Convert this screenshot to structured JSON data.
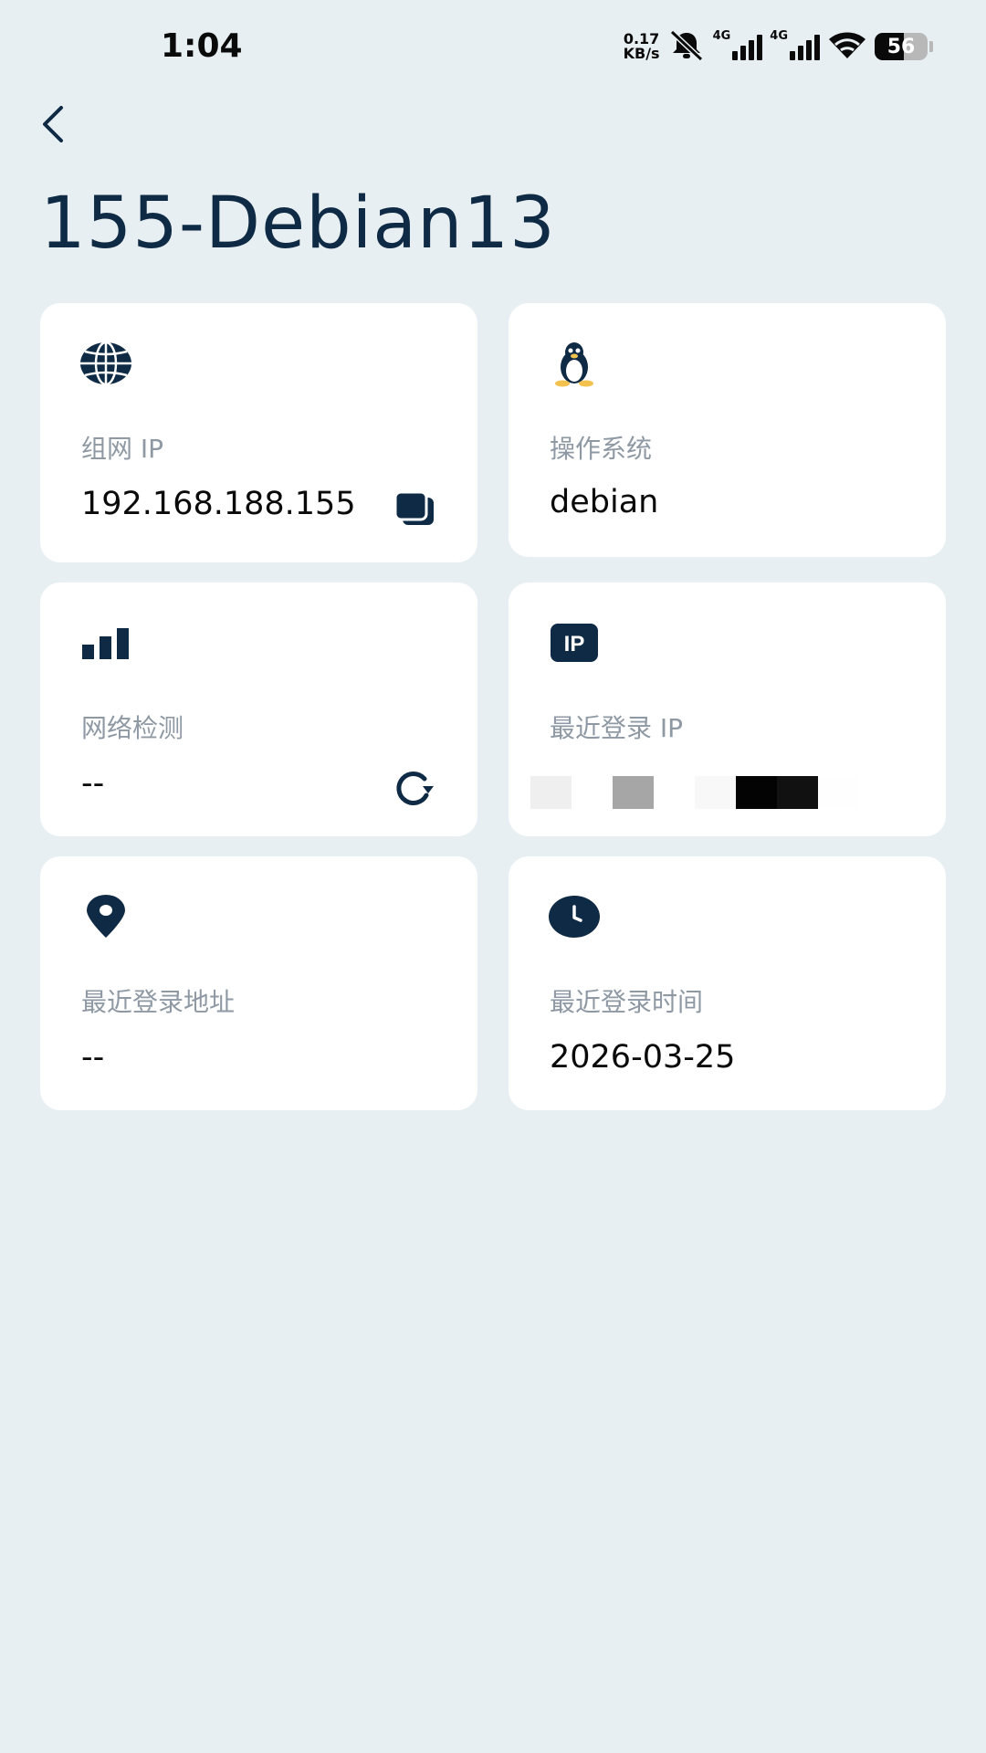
{
  "status_bar": {
    "time": "1:04",
    "net_speed_value": "0.17",
    "net_speed_unit": "KB/s",
    "network_type_1": "4G",
    "network_type_2": "4G",
    "battery": "56",
    "battery_level": 0.56
  },
  "header": {
    "title": "155-Debian13"
  },
  "cards": [
    {
      "icon": "globe-icon",
      "label": "组网 IP",
      "value": "192.168.188.155"
    },
    {
      "icon": "linux-penguin-icon",
      "label": "操作系统",
      "value": "debian"
    },
    {
      "icon": "signal-bars-icon",
      "label": "网络检测",
      "value": "--"
    },
    {
      "icon": "ip-badge-icon",
      "icon_text": "IP",
      "label": "最近登录 IP",
      "value": ""
    },
    {
      "icon": "location-pin-icon",
      "label": "最近登录地址",
      "value": "--"
    },
    {
      "icon": "clock-icon",
      "label": "最近登录时间",
      "value": "2026-03-25"
    }
  ],
  "colors": {
    "background": "#e8eff2",
    "card": "#ffffff",
    "accent": "#0f2a44",
    "label": "#8e99a4"
  }
}
